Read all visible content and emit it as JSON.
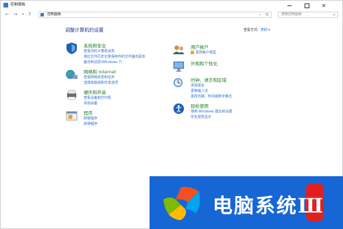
{
  "window": {
    "title": "控制面板"
  },
  "nav": {
    "breadcrumb": "控制面板",
    "search_placeholder": "搜索控制面板"
  },
  "main": {
    "heading": "调整计算机的设置",
    "view_by_label": "查看方式:",
    "view_by_value": "类别 ▾"
  },
  "categories": {
    "system": {
      "name": "系统和安全",
      "links": [
        "查看你的计算机状态",
        "通过文件历史记录保存你的文件备份副本",
        "备份和还原(Windows 7)"
      ]
    },
    "network": {
      "name": "网络和 Internet",
      "links": [
        "查看网络状态和任务",
        "选择家庭组和共享选项"
      ]
    },
    "hardware": {
      "name": "硬件和声音",
      "links": [
        "查看设备和打印机",
        "添加设备"
      ]
    },
    "programs": {
      "name": "程序",
      "links": [
        "卸载程序",
        "获得程序"
      ]
    },
    "accounts": {
      "name": "用户帐户",
      "links": [
        "更改帐户类型"
      ]
    },
    "appearance": {
      "name": "外观和个性化",
      "links": []
    },
    "clock": {
      "name": "时钟、语言和区域",
      "links": [
        "添加语言",
        "更换输入法",
        "更改日期、时间或数字格式"
      ]
    },
    "ease": {
      "name": "轻松使用",
      "links": [
        "使用 Windows 建议的设置",
        "优化视觉显示"
      ]
    }
  },
  "watermark": {
    "text": "电脑系统",
    "last_char": "Ш"
  },
  "icons": {
    "back": "back-arrow-icon",
    "forward": "forward-arrow-icon",
    "up": "up-arrow-icon",
    "refresh": "refresh-icon",
    "search": "search-icon"
  },
  "colors": {
    "link": "#2b6bd0",
    "category": "#1e7a1e",
    "heading": "#1e3287",
    "watermark_bg": "#1766d6"
  }
}
